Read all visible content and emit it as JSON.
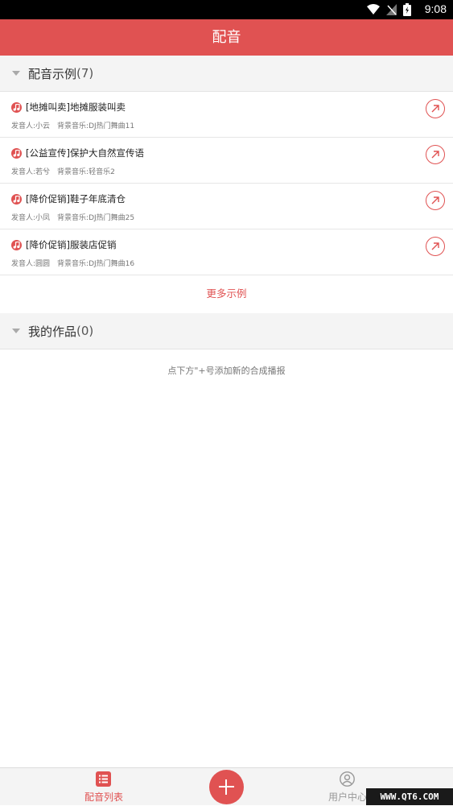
{
  "status_bar": {
    "time": "9:08"
  },
  "app_bar": {
    "title": "配音"
  },
  "samples_section": {
    "title": "配音示例",
    "count": "(7)"
  },
  "samples": [
    {
      "title": "[地摊叫卖]地摊服装叫卖",
      "speaker": "发音人:小云",
      "music": "背景音乐:DJ热门舞曲11"
    },
    {
      "title": "[公益宣传]保护大自然宣传语",
      "speaker": "发音人:若兮",
      "music": "背景音乐:轻音乐2"
    },
    {
      "title": "[降价促销]鞋子年底清仓",
      "speaker": "发音人:小凤",
      "music": "背景音乐:DJ热门舞曲25"
    },
    {
      "title": "[降价促销]服装店促销",
      "speaker": "发音人:圆圆",
      "music": "背景音乐:DJ热门舞曲16"
    }
  ],
  "more_samples": "更多示例",
  "works_section": {
    "title": "我的作品",
    "count": "(0)"
  },
  "empty_hint": "点下方\"+号添加新的合成播报",
  "bottom_nav": {
    "tab_list": "配音列表",
    "tab_user": "用户中心"
  },
  "watermark": "WWW.QT6.COM",
  "colors": {
    "accent": "#e05252",
    "header_bg": "#f4f4f4",
    "text_secondary": "#777777"
  }
}
